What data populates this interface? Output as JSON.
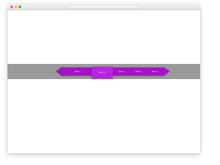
{
  "nav": {
    "items": [
      {
        "label": "Item 1"
      },
      {
        "label": "Item 2"
      },
      {
        "label": "Item 3"
      },
      {
        "label": "Item 4"
      },
      {
        "label": "Item 5"
      }
    ],
    "active_index": 1
  },
  "colors": {
    "ribbon": "#a612c9",
    "active_item": "#bc22e4",
    "strip": "#9a9a9a",
    "page_background": "#ffffff"
  }
}
